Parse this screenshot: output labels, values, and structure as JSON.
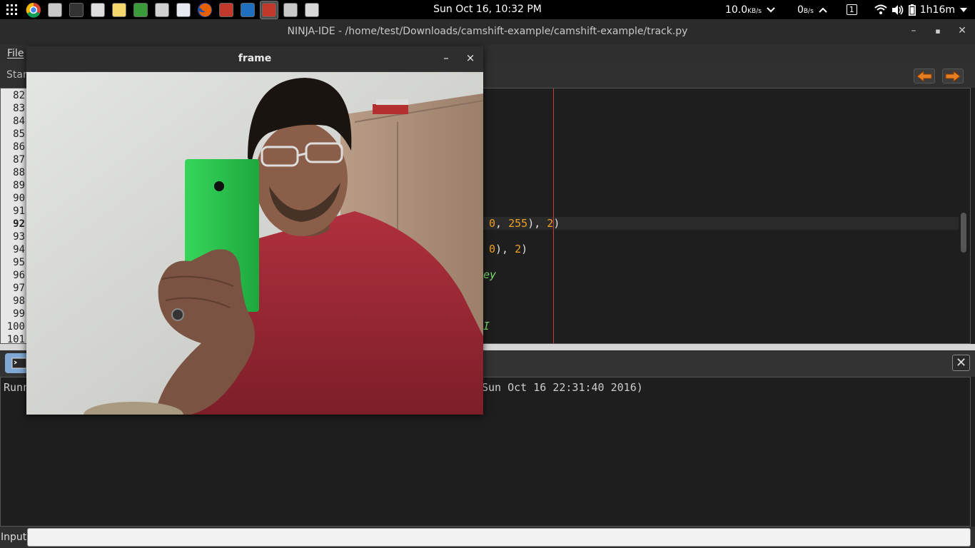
{
  "topbar": {
    "launchers": [
      {
        "name": "apps-grid-icon",
        "color": "#ffffff"
      },
      {
        "name": "chrome-icon",
        "color": "#4285f4"
      },
      {
        "name": "file-manager-icon",
        "color": "#c8c8c8"
      },
      {
        "name": "terminal-icon",
        "color": "#333333"
      },
      {
        "name": "settings-tools-icon",
        "color": "#dddddd"
      },
      {
        "name": "text-editor-icon",
        "color": "#f5d76e"
      },
      {
        "name": "system-monitor-icon",
        "color": "#3a9a3a"
      },
      {
        "name": "calculator-icon",
        "color": "#d0d0d0"
      },
      {
        "name": "disk-utility-icon",
        "color": "#e8e8f0"
      },
      {
        "name": "firefox-icon",
        "color": "#e66000"
      },
      {
        "name": "update-manager-icon",
        "color": "#c0392b"
      },
      {
        "name": "remote-desktop-icon",
        "color": "#1e6fbf"
      },
      {
        "name": "ninja-ide-icon",
        "color": "#c0392b",
        "active": true
      },
      {
        "name": "file-manager-2-icon",
        "color": "#c8c8c8"
      },
      {
        "name": "window-screenshot-icon",
        "color": "#d8d8d8"
      }
    ],
    "clock": "Sun Oct 16, 10:32 PM",
    "net_down_value": "10.0",
    "net_down_unit": "KB/s",
    "net_up_value": "0",
    "net_up_unit": "B/s",
    "workspace": "1",
    "battery": "1h16m"
  },
  "ide": {
    "title": "NINJA-IDE - /home/test/Downloads/camshift-example/camshift-example/track.py",
    "menu_file": "File",
    "tab_label": "Star",
    "line_numbers": [
      "82",
      "83",
      "84",
      "85",
      "86",
      "87",
      "88",
      "89",
      "90",
      "91",
      "92",
      "93",
      "94",
      "95",
      "96",
      "97",
      "98",
      "99",
      "100",
      "101"
    ],
    "current_line": "92",
    "code_fragments": {
      "line92_a": "0",
      "line92_b": ", ",
      "line92_c": "255",
      "line92_d": "), ",
      "line92_e": "2",
      "line92_f": ")",
      "line94_a": "0",
      "line94_b": "), ",
      "line94_c": "2",
      "line94_d": ")",
      "line96": "ey",
      "line100": "I"
    },
    "console_close": "✕",
    "console_output_left": "Runn",
    "console_output_right": "Sun Oct 16 22:31:40 2016)",
    "input_label": "Input:"
  },
  "frame": {
    "title": "frame",
    "minimize": "–",
    "close": "×"
  }
}
